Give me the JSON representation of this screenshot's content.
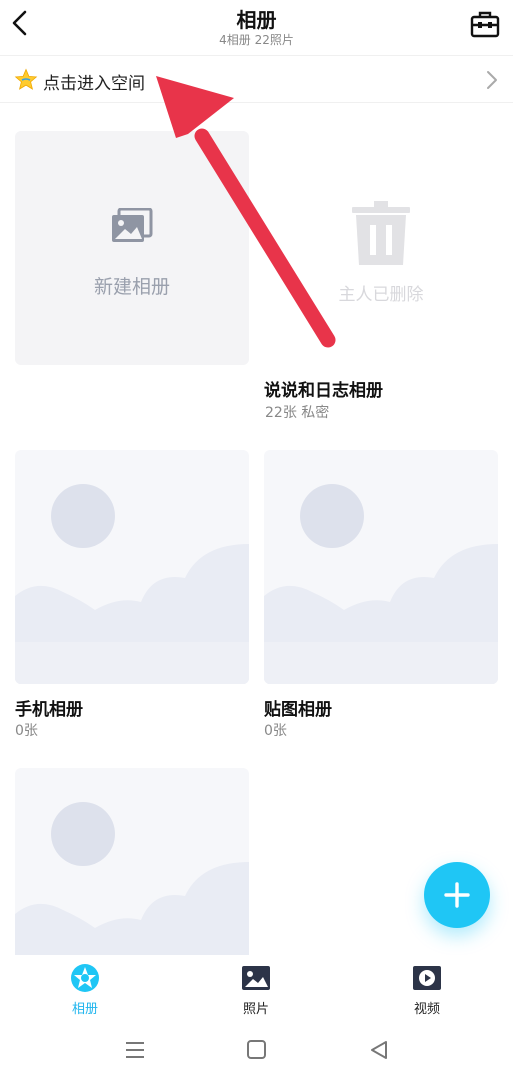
{
  "header": {
    "title": "相册",
    "subtitle": "4相册  22照片",
    "back_icon": "chevron-left-icon",
    "toolbox_icon": "toolbox-icon"
  },
  "space_banner": {
    "label": "点击进入空间",
    "icon": "star-icon",
    "chevron": "chevron-right-icon"
  },
  "albums": {
    "new_album": {
      "label": "新建相册",
      "icon": "add-photo-icon"
    },
    "deleted_album": {
      "label": "主人已删除",
      "icon": "trash-icon",
      "title": "说说和日志相册",
      "meta": "22张  私密"
    },
    "phone_album": {
      "title": "手机相册",
      "meta": "0张"
    },
    "sticker_album": {
      "title": "贴图相册",
      "meta": "0张"
    }
  },
  "fab": {
    "icon": "plus-icon"
  },
  "bottom_nav": [
    {
      "label": "相册",
      "icon": "album-icon",
      "active": true
    },
    {
      "label": "照片",
      "icon": "photo-icon",
      "active": false
    },
    {
      "label": "视频",
      "icon": "video-icon",
      "active": false
    }
  ],
  "system_bar": [
    "menu-icon",
    "home-icon",
    "back-triangle-icon"
  ],
  "colors": {
    "accent": "#1fc6f5",
    "annotation_arrow": "#e8344a",
    "placeholder_bg": "#f6f7fa",
    "placeholder_shape": "#dde1ec"
  }
}
